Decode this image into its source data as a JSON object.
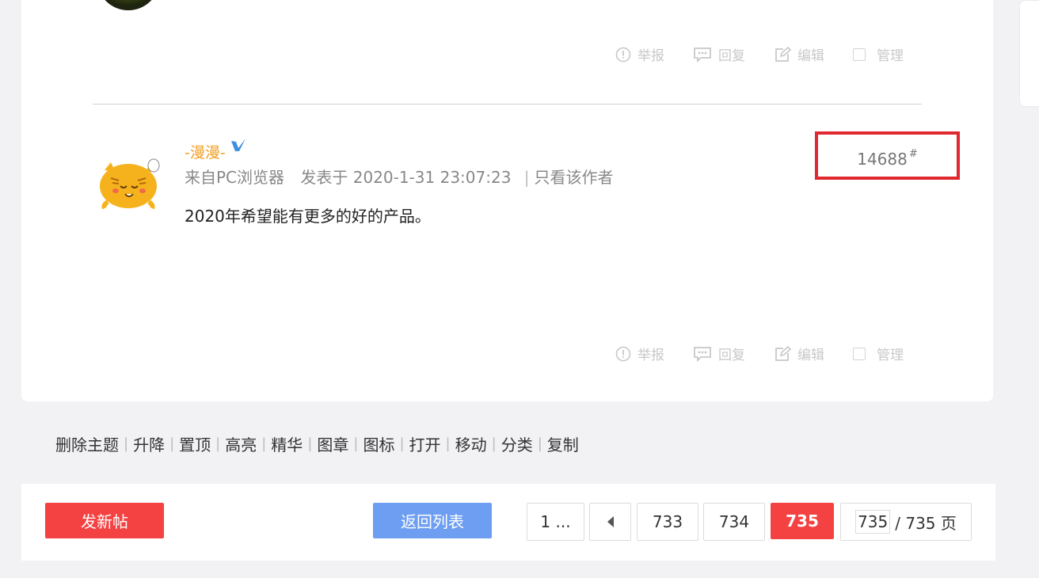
{
  "actions": {
    "report": "举报",
    "reply": "回复",
    "edit": "编辑",
    "manage": "管理"
  },
  "post": {
    "username": "-漫漫-",
    "source": "来自PC浏览器",
    "posted_at": "发表于 2020-1-31 23:07:23",
    "only_author": "只看该作者",
    "content": "2020年希望能有更多的好的产品。",
    "floor": "14688",
    "floor_mark": "#"
  },
  "admin_bar": [
    "删除主题",
    "升降",
    "置顶",
    "高亮",
    "精华",
    "图章",
    "图标",
    "打开",
    "移动",
    "分类",
    "复制"
  ],
  "bottom": {
    "new_post": "发新帖",
    "back_to_list": "返回列表",
    "pages": {
      "first": "1 ...",
      "prev_icon": "triangle-left",
      "p1": "733",
      "p2": "734",
      "current": "735",
      "input_value": "735",
      "total": "/ 735 页"
    }
  },
  "colors": {
    "accent_red": "#f44243",
    "accent_blue": "#6d9ef2",
    "username": "#f29d1d",
    "highlight_box": "#e0282f"
  }
}
